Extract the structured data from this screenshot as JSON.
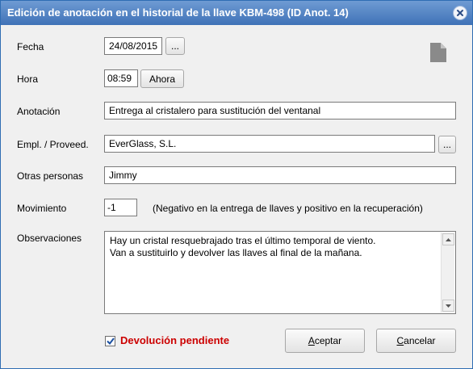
{
  "window": {
    "title": "Edición de anotación en el historial de la llave KBM-498 (ID Anot. 14)"
  },
  "form": {
    "fecha": {
      "label": "Fecha",
      "value": "24/08/2015",
      "picker_label": "..."
    },
    "hora": {
      "label": "Hora",
      "value": "08:59",
      "now_label": "Ahora"
    },
    "anotacion": {
      "label": "Anotación",
      "value": "Entrega al cristalero para sustitución del ventanal"
    },
    "empleado": {
      "label": "Empl. / Proveed.",
      "value": "EverGlass, S.L.",
      "picker_label": "..."
    },
    "otras": {
      "label": "Otras personas",
      "value": "Jimmy"
    },
    "movimiento": {
      "label": "Movimiento",
      "value": "-1",
      "hint": "(Negativo en la entrega de llaves y positivo en la recuperación)"
    },
    "observaciones": {
      "label": "Observaciones",
      "line1": "Hay un cristal resquebrajado tras el último temporal de viento.",
      "line2": "Van a sustituirlo y devolver las llaves al final de la mañana."
    },
    "devolucion": {
      "label": "Devolución pendiente",
      "checked": true
    }
  },
  "buttons": {
    "accept": {
      "accel": "A",
      "rest": "ceptar"
    },
    "cancel": {
      "accel": "C",
      "rest": "ancelar"
    }
  },
  "icons": {
    "document": "document-icon",
    "close": "close-icon"
  },
  "colors": {
    "title_bar": "#3f72b7",
    "devolucion_label": "#cc0000",
    "check": "#1a4fa0"
  }
}
